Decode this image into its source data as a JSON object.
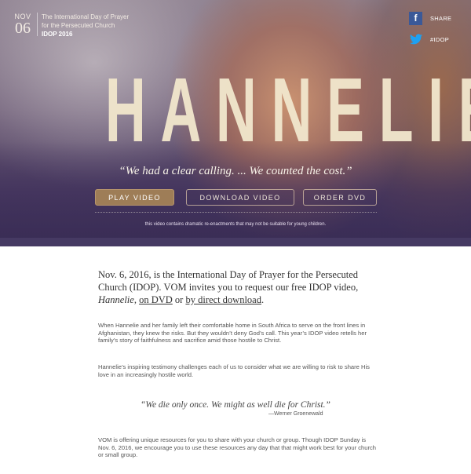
{
  "event": {
    "month": "NOV",
    "day": "06",
    "title_line1": "The International Day of Prayer",
    "title_line2": "for the Persecuted Church",
    "subtitle": "IDOP 2016"
  },
  "social": {
    "share_label": "SHARE",
    "hashtag_label": "#IDOP",
    "facebook_icon": "facebook-icon",
    "twitter_icon": "twitter-icon"
  },
  "hero": {
    "title": "HANNELIE",
    "tagline": "“We had a clear calling. ... We counted the cost.”",
    "disclaimer": "this video contains dramatic re-enactments that may not be suitable for young children."
  },
  "buttons": {
    "play": "PLAY VIDEO",
    "download": "DOWNLOAD VIDEO",
    "order": "ORDER DVD"
  },
  "intro": {
    "text_before": "Nov. 6, 2016, is the International Day of Prayer for the Persecuted Church (IDOP). VOM invites you to request our free IDOP video,",
    "film_title": "Hannelie",
    "comma": ",",
    "link_dvd": "on DVD",
    "or": "or",
    "link_download": "by direct download",
    "period": "."
  },
  "paragraphs": {
    "p1": "When Hannelie and her family left their comfortable home in South Africa to serve on the front lines in Afghanistan, they knew the risks. But they wouldn’t deny God’s call. This year’s IDOP video retells her family’s story of faithfulness and sacrifice amid those hostile to Christ.",
    "p2": "Hannelie’s inspiring testimony challenges each of us to consider what we are willing to risk to share His love in an increasingly hostile world.",
    "p3": "VOM is offering unique resources for you to share with your church or group. Though IDOP Sunday is Nov. 6, 2016, we encourage you to use these resources any day that that might work best for your church or small group."
  },
  "quote": {
    "text": "“We die only once. We might as well die for Christ.”",
    "attribution": "—Werner Groenewald"
  },
  "colors": {
    "play_button": "#9e7d57",
    "title": "#f1e6cc",
    "hero_band": "#463a63",
    "facebook": "#3b5998"
  }
}
